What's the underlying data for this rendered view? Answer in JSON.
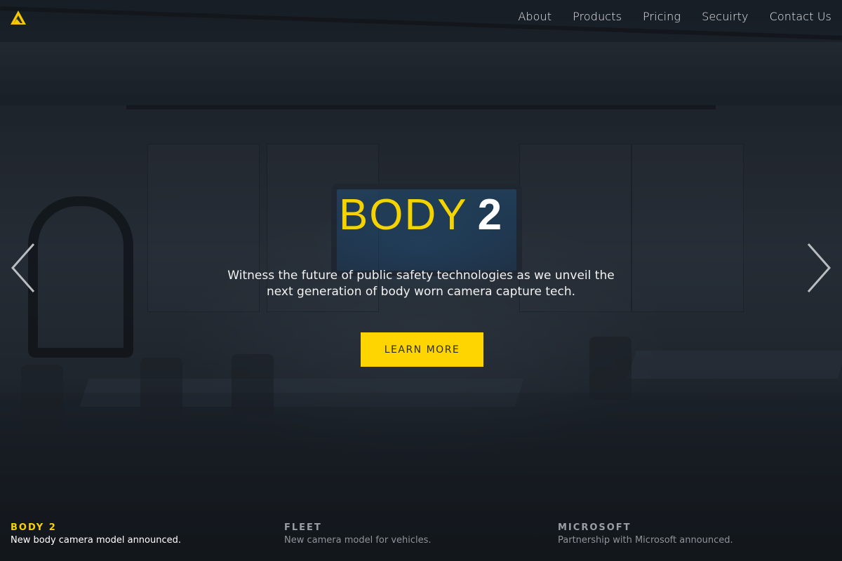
{
  "brand": {
    "logo_icon": "triangle-logo-icon",
    "accent": "#ffd500"
  },
  "nav": {
    "items": [
      {
        "label": "About"
      },
      {
        "label": "Products"
      },
      {
        "label": "Pricing"
      },
      {
        "label": "Secuirty"
      },
      {
        "label": "Contact Us"
      }
    ]
  },
  "hero": {
    "title_word": "BODY",
    "title_num": "2",
    "subtitle_line1": "Witness the future of public safety technologies as we unveil the",
    "subtitle_line2": "next generation of body worn camera capture tech.",
    "cta_label": "LEARN MORE",
    "prev_icon": "chevron-left-icon",
    "next_icon": "chevron-right-icon"
  },
  "slides": [
    {
      "title": "BODY 2",
      "desc": "New body camera model announced.",
      "active": true
    },
    {
      "title": "FLEET",
      "desc": "New camera model for vehicles.",
      "active": false
    },
    {
      "title": "MICROSOFT",
      "desc": "Partnership with Microsoft announced.",
      "active": false
    }
  ],
  "colors": {
    "accent_yellow": "#ffd500",
    "title_yellow": "#f5d300",
    "inactive_text": "#9a9ea4"
  }
}
